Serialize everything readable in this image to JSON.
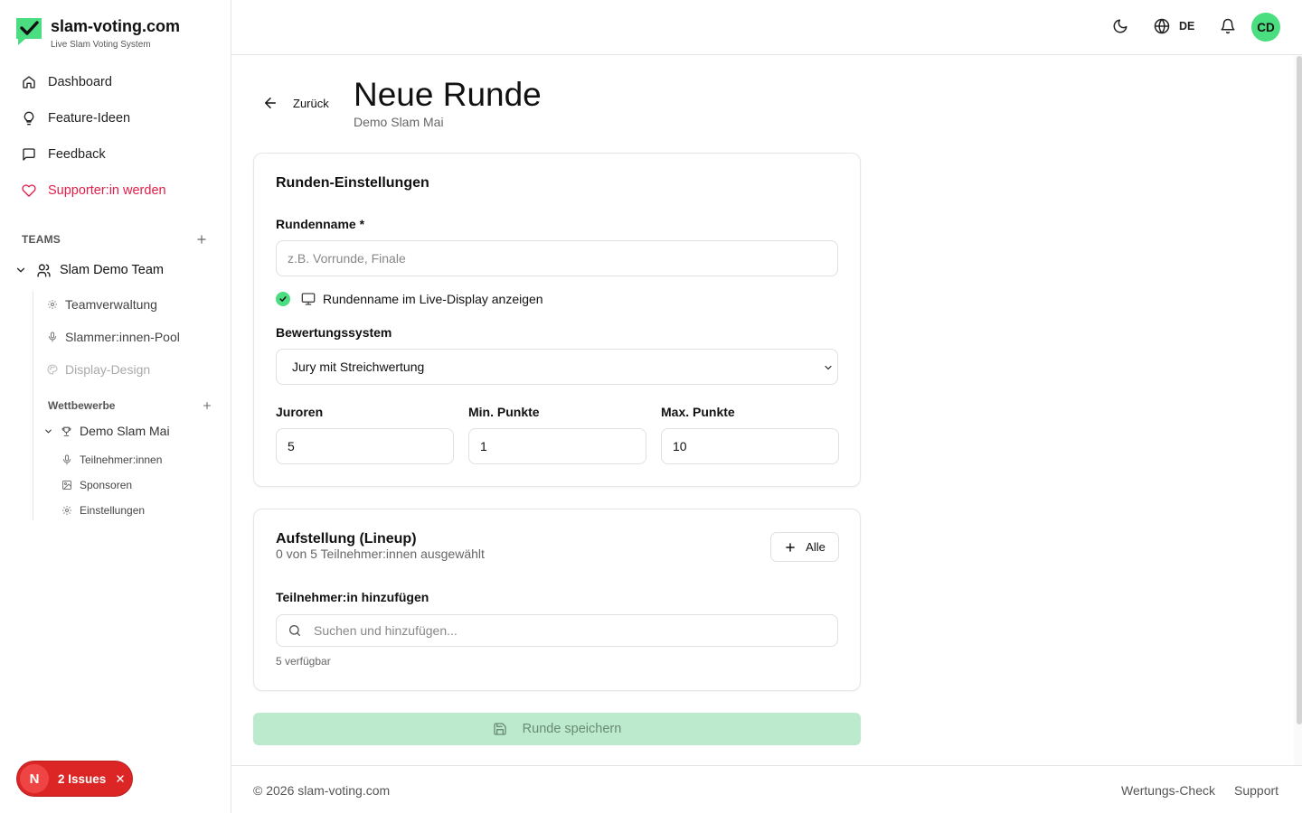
{
  "brand": {
    "name": "slam-voting.com",
    "tagline": "Live Slam Voting System"
  },
  "nav": {
    "dashboard": "Dashboard",
    "feature_ideas": "Feature-Ideen",
    "feedback": "Feedback",
    "supporter": "Supporter:in werden"
  },
  "teams": {
    "label": "TEAMS",
    "team_name": "Slam Demo Team",
    "items": [
      "Teamverwaltung",
      "Slammer:innen-Pool",
      "Display-Design"
    ],
    "competitions_label": "Wettbewerbe",
    "competition": {
      "name": "Demo Slam Mai",
      "items": [
        "Teilnehmer:innen",
        "Sponsoren",
        "Einstellungen"
      ]
    }
  },
  "issues": {
    "badge": "N",
    "label": "2 Issues"
  },
  "header": {
    "language": "DE",
    "avatar_initials": "CD"
  },
  "page": {
    "back_label": "Zurück",
    "title": "Neue Runde",
    "subtitle": "Demo Slam Mai"
  },
  "settings": {
    "title": "Runden-Einstellungen",
    "round_name_label": "Rundenname *",
    "round_name_placeholder": "z.B. Vorrunde, Finale",
    "show_in_display_label": "Rundenname im Live-Display anzeigen",
    "show_in_display_checked": true,
    "scoring_label": "Bewertungssystem",
    "scoring_value": "Jury mit Streichwertung",
    "jurors_label": "Juroren",
    "jurors_value": "5",
    "min_label": "Min. Punkte",
    "min_value": "1",
    "max_label": "Max. Punkte",
    "max_value": "10"
  },
  "lineup": {
    "title": "Aufstellung (Lineup)",
    "subtitle": "0 von 5 Teilnehmer:innen ausgewählt",
    "all_button": "Alle",
    "add_label": "Teilnehmer:in hinzufügen",
    "search_placeholder": "Suchen und hinzufügen...",
    "available": "5 verfügbar"
  },
  "save_button": "Runde speichern",
  "footer": {
    "copyright": "© 2026 slam-voting.com",
    "links": [
      "Wertungs-Check",
      "Support"
    ]
  },
  "colors": {
    "accent_green": "#4ade80",
    "save_disabled": "#bbebcc",
    "supporter_red": "#e11d48",
    "issues_red": "#dc2626"
  }
}
